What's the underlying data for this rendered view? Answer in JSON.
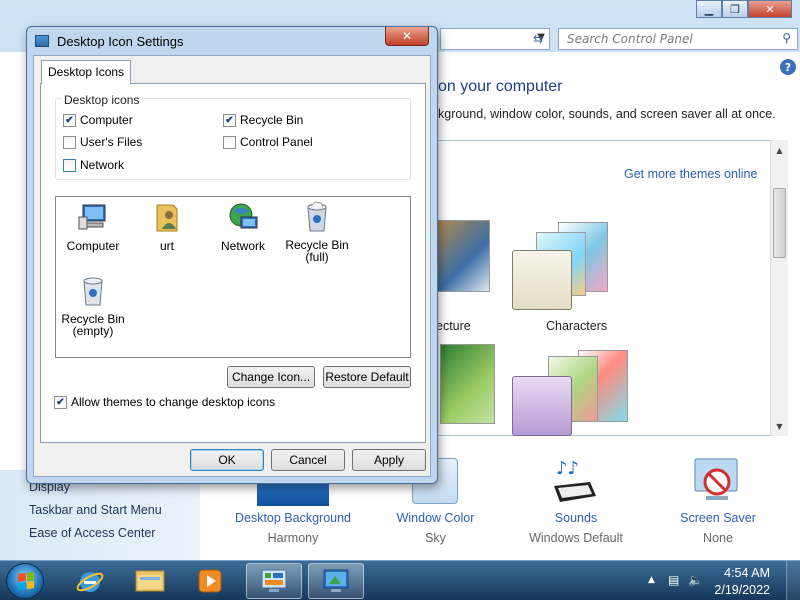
{
  "background_window": {
    "search_placeholder": "Search Control Panel",
    "heading": "on your computer",
    "subheading": "kground, window color, sounds, and screen saver all at once.",
    "get_more_themes": "Get more themes online",
    "themes": [
      {
        "label": "ecture"
      },
      {
        "label": "Characters"
      }
    ],
    "sidebar_links": [
      "Display",
      "Taskbar and Start Menu",
      "Ease of Access Center"
    ],
    "bottom_items": [
      {
        "link": "Desktop Background",
        "sub": "Harmony"
      },
      {
        "link": "Window Color",
        "sub": "Sky"
      },
      {
        "link": "Sounds",
        "sub": "Windows Default"
      },
      {
        "link": "Screen Saver",
        "sub": "None"
      }
    ],
    "help_glyph": "?"
  },
  "dialog": {
    "title": "Desktop Icon Settings",
    "tab": "Desktop Icons",
    "group_label": "Desktop icons",
    "checkboxes": [
      {
        "label": "Computer",
        "checked": true
      },
      {
        "label": "Recycle Bin",
        "checked": true
      },
      {
        "label": "User's Files",
        "checked": false
      },
      {
        "label": "Control Panel",
        "checked": false
      },
      {
        "label": "Network",
        "checked": false
      }
    ],
    "icons": [
      {
        "label": "Computer",
        "icon": "computer-icon"
      },
      {
        "label": "urt",
        "icon": "user-folder-icon"
      },
      {
        "label": "Network",
        "icon": "network-icon"
      },
      {
        "label": "Recycle Bin\n(full)",
        "icon": "recycle-bin-full-icon"
      },
      {
        "label": "Recycle Bin\n(empty)",
        "icon": "recycle-bin-empty-icon"
      }
    ],
    "change_icon": "Change Icon...",
    "restore_default": "Restore Default",
    "allow_themes": "Allow themes to change desktop icons",
    "allow_themes_checked": true,
    "ok": "OK",
    "cancel": "Cancel",
    "apply": "Apply",
    "close_glyph": "✕"
  },
  "taskbar": {
    "time": "4:54 AM",
    "date": "2/19/2022"
  },
  "colors": {
    "link": "#2a62b9",
    "heading": "#1e3f8c",
    "taskbar": "#17375a"
  }
}
